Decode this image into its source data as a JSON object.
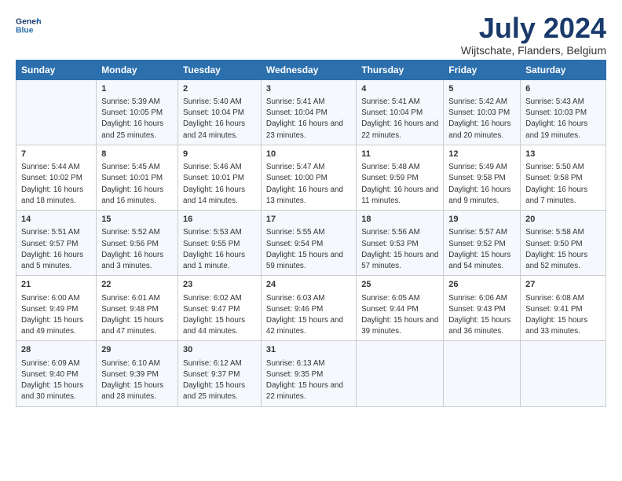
{
  "logo": {
    "text_general": "General",
    "text_blue": "Blue"
  },
  "title": "July 2024",
  "subtitle": "Wijtschate, Flanders, Belgium",
  "days_header": [
    "Sunday",
    "Monday",
    "Tuesday",
    "Wednesday",
    "Thursday",
    "Friday",
    "Saturday"
  ],
  "weeks": [
    [
      {
        "day": "",
        "content": ""
      },
      {
        "day": "1",
        "content": "Sunrise: 5:39 AM\nSunset: 10:05 PM\nDaylight: 16 hours\nand 25 minutes."
      },
      {
        "day": "2",
        "content": "Sunrise: 5:40 AM\nSunset: 10:04 PM\nDaylight: 16 hours\nand 24 minutes."
      },
      {
        "day": "3",
        "content": "Sunrise: 5:41 AM\nSunset: 10:04 PM\nDaylight: 16 hours\nand 23 minutes."
      },
      {
        "day": "4",
        "content": "Sunrise: 5:41 AM\nSunset: 10:04 PM\nDaylight: 16 hours\nand 22 minutes."
      },
      {
        "day": "5",
        "content": "Sunrise: 5:42 AM\nSunset: 10:03 PM\nDaylight: 16 hours\nand 20 minutes."
      },
      {
        "day": "6",
        "content": "Sunrise: 5:43 AM\nSunset: 10:03 PM\nDaylight: 16 hours\nand 19 minutes."
      }
    ],
    [
      {
        "day": "7",
        "content": "Sunrise: 5:44 AM\nSunset: 10:02 PM\nDaylight: 16 hours\nand 18 minutes."
      },
      {
        "day": "8",
        "content": "Sunrise: 5:45 AM\nSunset: 10:01 PM\nDaylight: 16 hours\nand 16 minutes."
      },
      {
        "day": "9",
        "content": "Sunrise: 5:46 AM\nSunset: 10:01 PM\nDaylight: 16 hours\nand 14 minutes."
      },
      {
        "day": "10",
        "content": "Sunrise: 5:47 AM\nSunset: 10:00 PM\nDaylight: 16 hours\nand 13 minutes."
      },
      {
        "day": "11",
        "content": "Sunrise: 5:48 AM\nSunset: 9:59 PM\nDaylight: 16 hours\nand 11 minutes."
      },
      {
        "day": "12",
        "content": "Sunrise: 5:49 AM\nSunset: 9:58 PM\nDaylight: 16 hours\nand 9 minutes."
      },
      {
        "day": "13",
        "content": "Sunrise: 5:50 AM\nSunset: 9:58 PM\nDaylight: 16 hours\nand 7 minutes."
      }
    ],
    [
      {
        "day": "14",
        "content": "Sunrise: 5:51 AM\nSunset: 9:57 PM\nDaylight: 16 hours\nand 5 minutes."
      },
      {
        "day": "15",
        "content": "Sunrise: 5:52 AM\nSunset: 9:56 PM\nDaylight: 16 hours\nand 3 minutes."
      },
      {
        "day": "16",
        "content": "Sunrise: 5:53 AM\nSunset: 9:55 PM\nDaylight: 16 hours\nand 1 minute."
      },
      {
        "day": "17",
        "content": "Sunrise: 5:55 AM\nSunset: 9:54 PM\nDaylight: 15 hours\nand 59 minutes."
      },
      {
        "day": "18",
        "content": "Sunrise: 5:56 AM\nSunset: 9:53 PM\nDaylight: 15 hours\nand 57 minutes."
      },
      {
        "day": "19",
        "content": "Sunrise: 5:57 AM\nSunset: 9:52 PM\nDaylight: 15 hours\nand 54 minutes."
      },
      {
        "day": "20",
        "content": "Sunrise: 5:58 AM\nSunset: 9:50 PM\nDaylight: 15 hours\nand 52 minutes."
      }
    ],
    [
      {
        "day": "21",
        "content": "Sunrise: 6:00 AM\nSunset: 9:49 PM\nDaylight: 15 hours\nand 49 minutes."
      },
      {
        "day": "22",
        "content": "Sunrise: 6:01 AM\nSunset: 9:48 PM\nDaylight: 15 hours\nand 47 minutes."
      },
      {
        "day": "23",
        "content": "Sunrise: 6:02 AM\nSunset: 9:47 PM\nDaylight: 15 hours\nand 44 minutes."
      },
      {
        "day": "24",
        "content": "Sunrise: 6:03 AM\nSunset: 9:46 PM\nDaylight: 15 hours\nand 42 minutes."
      },
      {
        "day": "25",
        "content": "Sunrise: 6:05 AM\nSunset: 9:44 PM\nDaylight: 15 hours\nand 39 minutes."
      },
      {
        "day": "26",
        "content": "Sunrise: 6:06 AM\nSunset: 9:43 PM\nDaylight: 15 hours\nand 36 minutes."
      },
      {
        "day": "27",
        "content": "Sunrise: 6:08 AM\nSunset: 9:41 PM\nDaylight: 15 hours\nand 33 minutes."
      }
    ],
    [
      {
        "day": "28",
        "content": "Sunrise: 6:09 AM\nSunset: 9:40 PM\nDaylight: 15 hours\nand 30 minutes."
      },
      {
        "day": "29",
        "content": "Sunrise: 6:10 AM\nSunset: 9:39 PM\nDaylight: 15 hours\nand 28 minutes."
      },
      {
        "day": "30",
        "content": "Sunrise: 6:12 AM\nSunset: 9:37 PM\nDaylight: 15 hours\nand 25 minutes."
      },
      {
        "day": "31",
        "content": "Sunrise: 6:13 AM\nSunset: 9:35 PM\nDaylight: 15 hours\nand 22 minutes."
      },
      {
        "day": "",
        "content": ""
      },
      {
        "day": "",
        "content": ""
      },
      {
        "day": "",
        "content": ""
      }
    ]
  ]
}
